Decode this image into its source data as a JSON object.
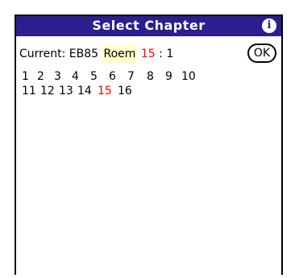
{
  "window": {
    "title": "Select Chapter",
    "info_icon": "info-icon"
  },
  "current": {
    "label": "Current:",
    "version": "EB85",
    "book": "Roem",
    "chapter": "15",
    "separator": ":",
    "verse": "1"
  },
  "ok_button": {
    "label": "OK"
  },
  "chapters": {
    "rows": [
      [
        "1",
        "2",
        "3",
        "4",
        "5",
        "6",
        "7",
        "8",
        "9",
        "10"
      ],
      [
        "11",
        "12",
        "13",
        "14",
        "15",
        "16"
      ]
    ],
    "selected": "15"
  },
  "colors": {
    "titlebar": "#2b1f8f",
    "highlight": "#ffffcc",
    "selected": "#ff0000"
  }
}
